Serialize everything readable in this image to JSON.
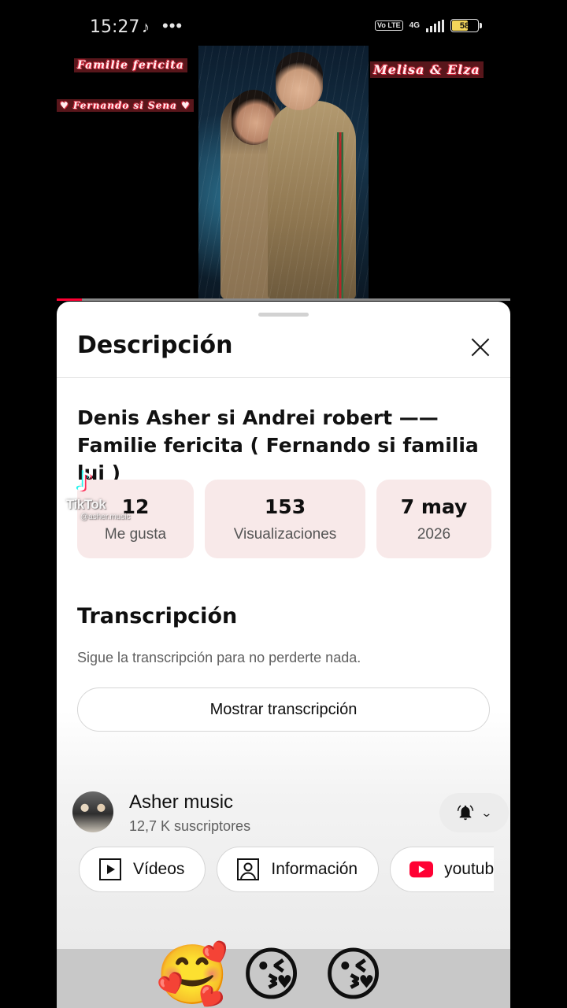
{
  "status_bar": {
    "time": "15:27",
    "tiktok_glyph": "♪",
    "dots": "•••",
    "volte": "Vo LTE",
    "network": "4G",
    "battery": "58"
  },
  "video": {
    "overlay_tags": [
      "Familie fericita",
      "Melisa & Elza",
      "♥ Fernando si Sena ♥"
    ],
    "progress_fraction": 0.055
  },
  "description_sheet": {
    "title": "Descripción",
    "video_title": "Denis Asher si Andrei robert —— Familie fericita ( Fernando si familia lui )",
    "stats": [
      {
        "value": "12",
        "label": "Me gusta"
      },
      {
        "value": "153",
        "label": "Visualizaciones"
      },
      {
        "value": "7 may",
        "label": "2026"
      }
    ],
    "watermark": {
      "logo": "♪",
      "name": "TikTok",
      "user": "@asher.music"
    },
    "transcript": {
      "title": "Transcripción",
      "subtitle": "Sigue la transcripción para no perderte nada.",
      "button": "Mostrar transcripción"
    },
    "channel": {
      "name": "Asher music",
      "subscribers": "12,7 K suscriptores"
    },
    "chips": [
      {
        "label": "Vídeos",
        "icon": "play-box-icon"
      },
      {
        "label": "Información",
        "icon": "person-box-icon"
      },
      {
        "label": "youtub",
        "icon": "youtube-logo-icon"
      }
    ]
  },
  "emojis": [
    "🥰",
    "😘",
    "😘"
  ],
  "colors": {
    "accent_red": "#ff0033",
    "stat_bg": "#f8e9e9"
  }
}
